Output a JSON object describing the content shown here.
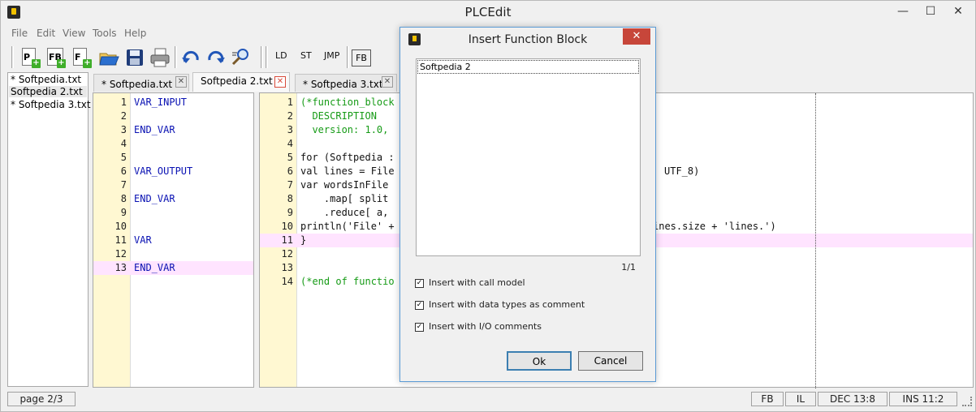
{
  "window": {
    "title": "PLCEdit",
    "minimize": "—",
    "maximize": "☐",
    "close": "✕"
  },
  "menu": [
    "File",
    "Edit",
    "View",
    "Tools",
    "Help"
  ],
  "toolbar": {
    "new_program": "P",
    "new_function_block": "FB",
    "new_function": "F",
    "ld": "LD",
    "st": "ST",
    "jmp": "JMP",
    "fb": "FB",
    "colors": {
      "open": "#2b6fcf",
      "save": "#1f3c7a",
      "undo": "#2156b8"
    }
  },
  "files": [
    "* Softpedia.txt",
    "Softpedia 2.txt",
    "* Softpedia 3.txt"
  ],
  "tabs": [
    {
      "label": "* Softpedia.txt"
    },
    {
      "label": "Softpedia 2.txt"
    },
    {
      "label": "* Softpedia 3.txt"
    }
  ],
  "left_editor": {
    "lines": [
      {
        "n": "1",
        "t": "VAR_INPUT"
      },
      {
        "n": "2",
        "t": ""
      },
      {
        "n": "3",
        "t": "END_VAR"
      },
      {
        "n": "4",
        "t": ""
      },
      {
        "n": "5",
        "t": ""
      },
      {
        "n": "6",
        "t": "VAR_OUTPUT"
      },
      {
        "n": "7",
        "t": ""
      },
      {
        "n": "8",
        "t": "END_VAR"
      },
      {
        "n": "9",
        "t": ""
      },
      {
        "n": "10",
        "t": ""
      },
      {
        "n": "11",
        "t": "VAR"
      },
      {
        "n": "12",
        "t": ""
      },
      {
        "n": "13",
        "t": "END_VAR"
      }
    ]
  },
  "right_editor": {
    "lines": [
      {
        "n": "1",
        "t": "(*function_block"
      },
      {
        "n": "2",
        "t": "  DESCRIPTION"
      },
      {
        "n": "3",
        "t": "  version: 1.0,"
      },
      {
        "n": "4",
        "t": ""
      },
      {
        "n": "5",
        "t": "for (Softpedia :"
      },
      {
        "n": "6",
        "t": "val lines = File"
      },
      {
        "n": "7",
        "t": "var wordsInFile"
      },
      {
        "n": "8",
        "t": "    .map[ split"
      },
      {
        "n": "9",
        "t": "    .reduce[ a,"
      },
      {
        "n": "10",
        "t": "println('File' +"
      },
      {
        "n": "11",
        "t": "}"
      },
      {
        "n": "12",
        "t": ""
      },
      {
        "n": "13",
        "t": ""
      },
      {
        "n": "14",
        "t": "(*end of functio"
      }
    ],
    "tail_6": "UTF_8)",
    "tail_10": "ines.size + 'lines.')"
  },
  "status": {
    "page": "page 2/3",
    "mode": "FB",
    "lang": "IL",
    "pos": "DEC 13:8",
    "ins": "INS 11:2"
  },
  "dialog": {
    "title": "Insert Function Block",
    "list_items": [
      "Softpedia 2"
    ],
    "pager": "1/1",
    "options": [
      {
        "label": "Insert with call model",
        "checked": true
      },
      {
        "label": "Insert with data types as comment",
        "checked": true
      },
      {
        "label": "Insert with I/O comments",
        "checked": true
      }
    ],
    "ok": "Ok",
    "cancel": "Cancel",
    "close": "✕"
  }
}
